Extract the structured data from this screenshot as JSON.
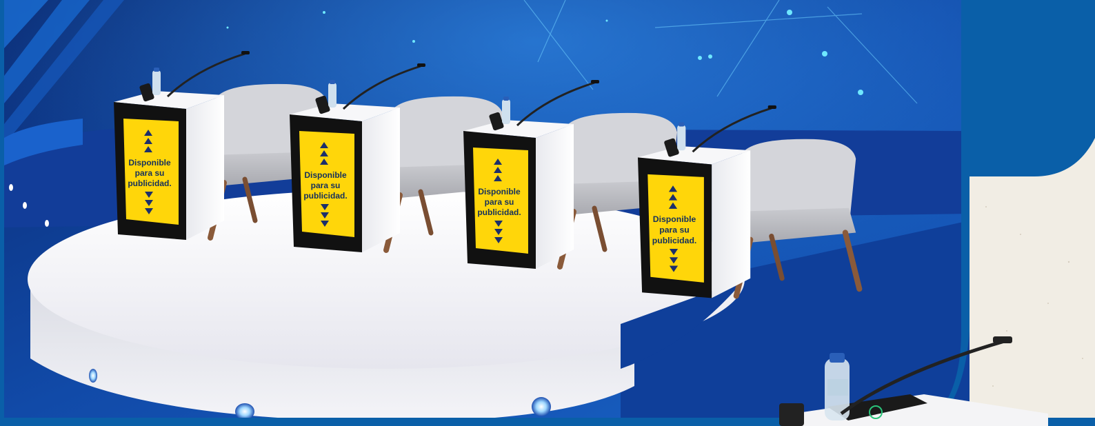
{
  "ad_panels": [
    {
      "line1": "Disponible",
      "line2": "para su",
      "line3": "publicidad."
    },
    {
      "line1": "Disponible",
      "line2": "para su",
      "line3": "publicidad."
    },
    {
      "line1": "Disponible",
      "line2": "para su",
      "line3": "publicidad."
    },
    {
      "line1": "Disponible",
      "line2": "para su",
      "line3": "publicidad."
    }
  ],
  "colors": {
    "backdrop_dark": "#0a2f7a",
    "backdrop_light": "#1e73d8",
    "accent_cyan": "#3fe0ff",
    "ad_yellow": "#ffd60a",
    "ad_border": "#111111",
    "stage_white": "#f2f2f5",
    "frame_blue": "#0a5fa8",
    "paper": "#f1ede4"
  }
}
